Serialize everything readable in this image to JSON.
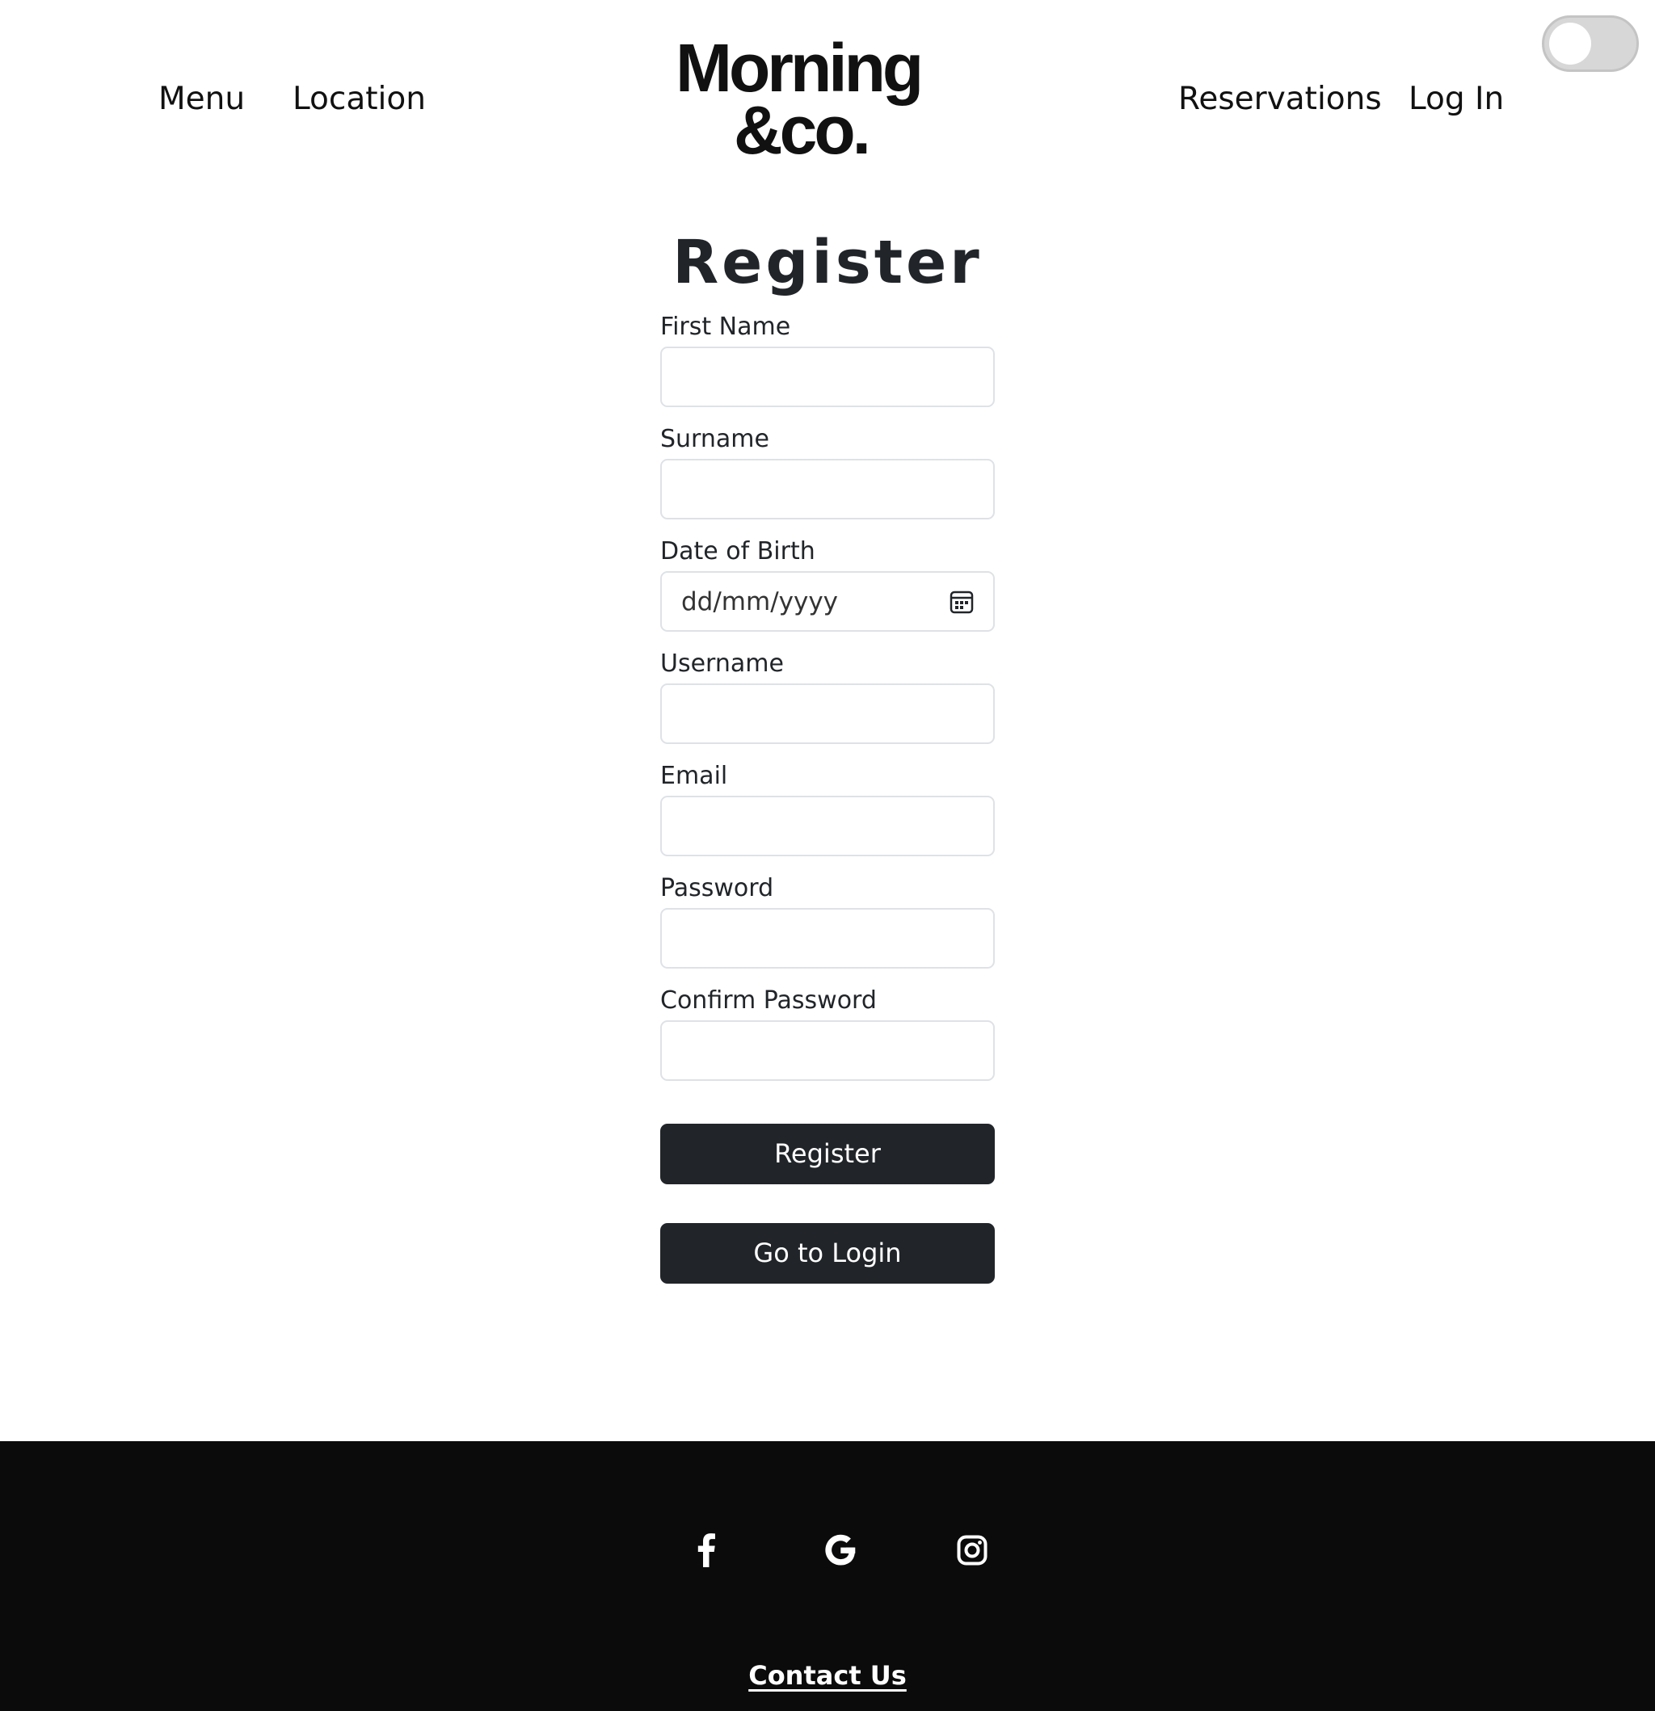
{
  "header": {
    "nav_left": [
      "Menu",
      "Location"
    ],
    "nav_right": [
      "Reservations",
      "Log In"
    ],
    "logo_line1": "Morning",
    "logo_line2": "&co.",
    "theme_toggle": "off"
  },
  "form": {
    "title": "Register",
    "fields": [
      {
        "label": "First Name",
        "value": ""
      },
      {
        "label": "Surname",
        "value": ""
      },
      {
        "label": "Date of Birth",
        "placeholder": "dd/mm/yyyy"
      },
      {
        "label": "Username",
        "value": ""
      },
      {
        "label": "Email",
        "value": ""
      },
      {
        "label": "Password",
        "value": ""
      },
      {
        "label": "Confirm Password",
        "value": ""
      }
    ],
    "register_label": "Register",
    "login_label": "Go to Login"
  },
  "footer": {
    "social": [
      "facebook-icon",
      "google-icon",
      "instagram-icon"
    ],
    "contact_label": "Contact Us"
  },
  "colors": {
    "primary_button": "#212529",
    "footer_bg": "#0b0b0c",
    "toggle_track": "#d7d7d7"
  }
}
